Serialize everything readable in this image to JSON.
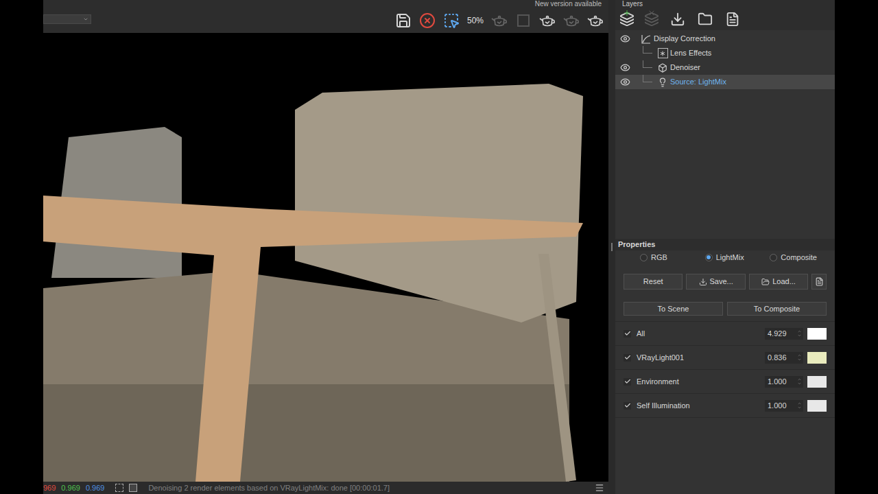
{
  "toolbar": {
    "notice": "New version available",
    "zoom": "50%"
  },
  "layers": {
    "title": "Layers",
    "tree": [
      {
        "label": "Display Correction",
        "kind": "correction",
        "visible": true,
        "selected": false,
        "expanded": true,
        "children": [
          {
            "label": "Lens Effects",
            "kind": "lens",
            "visible": false,
            "selected": false
          },
          {
            "label": "Denoiser",
            "kind": "denoiser",
            "visible": true,
            "selected": false
          },
          {
            "label": "Source: LightMix",
            "kind": "source",
            "visible": true,
            "selected": true
          }
        ]
      }
    ]
  },
  "properties": {
    "title": "Properties",
    "modes": [
      {
        "label": "RGB",
        "selected": false
      },
      {
        "label": "LightMix",
        "selected": true
      },
      {
        "label": "Composite",
        "selected": false
      }
    ],
    "buttons": [
      "Reset",
      "Save...",
      "Load..."
    ],
    "actions": [
      "To Scene",
      "To Composite"
    ],
    "lights": [
      {
        "name": "All",
        "checked": true,
        "value": "4.929",
        "color": "#ffffff"
      },
      {
        "name": "VRayLight001",
        "checked": true,
        "value": "0.836",
        "color": "#e9ebbd"
      },
      {
        "name": "Environment",
        "checked": true,
        "value": "1.000",
        "color": "#e8e8e8"
      },
      {
        "name": "Self Illumination",
        "checked": true,
        "value": "1.000",
        "color": "#e8e8e8"
      }
    ]
  },
  "status_bar": {
    "readouts": [
      {
        "text": "969",
        "color": "#e04a3f"
      },
      {
        "text": "0.969",
        "color": "#4fc24f"
      },
      {
        "text": "0.969",
        "color": "#4f8fe0"
      }
    ],
    "message": "Denoising 2 render elements based on VRayLightMix: done [00:00:01.7]"
  }
}
